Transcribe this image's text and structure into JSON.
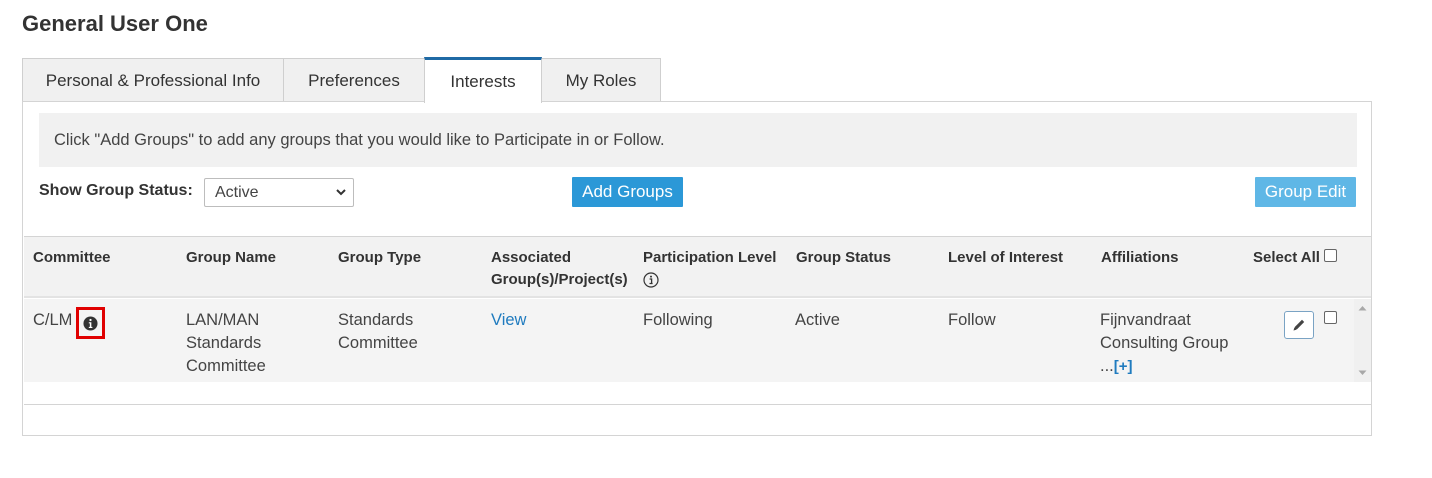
{
  "page": {
    "title": "General User One"
  },
  "tabs": [
    {
      "label": "Personal & Professional Info"
    },
    {
      "label": "Preferences"
    },
    {
      "label": "Interests"
    },
    {
      "label": "My Roles"
    }
  ],
  "banner": {
    "text": "Click \"Add Groups\" to add any groups that you would like to Participate in or Follow."
  },
  "filter": {
    "label": "Show Group Status:",
    "selected": "Active"
  },
  "buttons": {
    "add_groups": "Add Groups",
    "group_edit": "Group Edit"
  },
  "table": {
    "headers": {
      "committee": "Committee",
      "group_name": "Group Name",
      "group_type": "Group Type",
      "associated_1": "Associated",
      "associated_2": "Group(s)/Project(s)",
      "participation": "Participation Level",
      "group_status": "Group Status",
      "level_of_interest": "Level of Interest",
      "affiliations": "Affiliations",
      "select_all": "Select All"
    },
    "rows": [
      {
        "committee": "C/LM",
        "group_name_1": "LAN/MAN",
        "group_name_2": "Standards",
        "group_name_3": "Committee",
        "group_type_1": "Standards",
        "group_type_2": "Committee",
        "associated": "View",
        "participation": "Following",
        "group_status": "Active",
        "level_of_interest": "Follow",
        "affiliation_1": "Fijnvandraat",
        "affiliation_2": "Consulting Group",
        "affiliation_more_prefix": "...",
        "affiliation_more_link": "[+]"
      }
    ]
  },
  "icons": {
    "info": "info-circle-icon",
    "edit": "pencil-icon",
    "select_chevron": "chevron-down-icon"
  },
  "colors": {
    "primary_button": "#2b98d7",
    "secondary_button": "#5fb7e6",
    "active_tab_border": "#1f6aa5",
    "link": "#1f7bbf",
    "highlight_box": "#e00000"
  }
}
